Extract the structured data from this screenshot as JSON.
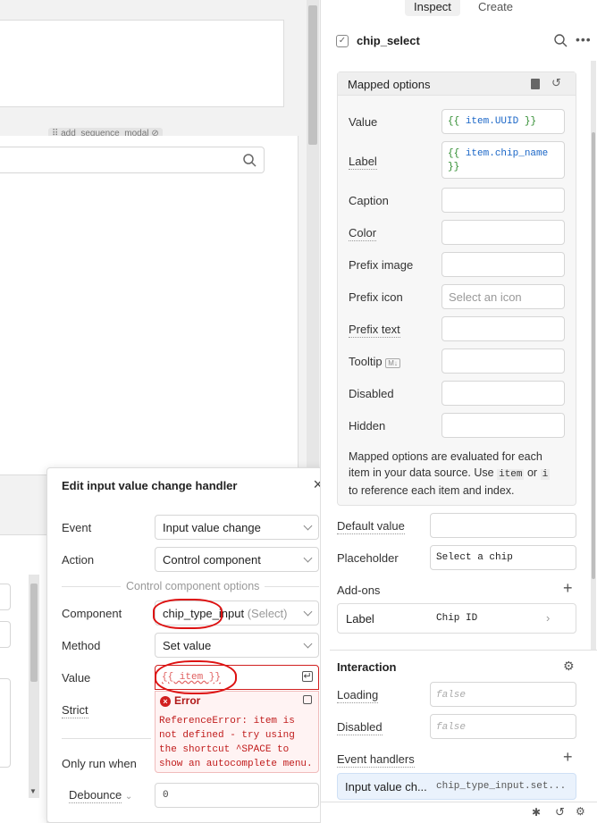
{
  "tabs": {
    "inspect": "Inspect",
    "create": "Create"
  },
  "component": {
    "name": "chip_select"
  },
  "mapped_options": {
    "title": "Mapped options",
    "value_label": "Value",
    "value": "{{ item.UUID }}",
    "label_label": "Label",
    "label_line1": "{{ item.chip_name",
    "label_line2": "}}",
    "caption_label": "Caption",
    "color_label": "Color",
    "prefix_image_label": "Prefix image",
    "prefix_icon_label": "Prefix icon",
    "prefix_icon_placeholder": "Select an icon",
    "prefix_text_label": "Prefix text",
    "tooltip_label": "Tooltip",
    "tooltip_badge": "M↓",
    "disabled_label": "Disabled",
    "hidden_label": "Hidden",
    "help_1": "Mapped options are evaluated for each",
    "help_2a": "item in your data source. Use",
    "help_code1": "item",
    "help_or": "or",
    "help_code2": "i",
    "help_3": "to reference each item and index."
  },
  "default_value_label": "Default value",
  "placeholder_label": "Placeholder",
  "placeholder_value": "Select a chip",
  "addons": {
    "title": "Add-ons",
    "label": "Label",
    "value": "Chip ID"
  },
  "interaction": {
    "title": "Interaction",
    "loading_label": "Loading",
    "loading_value": "false",
    "disabled_label": "Disabled",
    "disabled_value": "false",
    "event_handlers_label": "Event handlers",
    "handler_event": "Input value ch...",
    "handler_action": "chip_type_input.set..."
  },
  "canvas": {
    "modal_tag": "add_sequence_modal"
  },
  "modal": {
    "title": "Edit input value change handler",
    "event_label": "Event",
    "event_value": "Input value change",
    "action_label": "Action",
    "action_value": "Control component",
    "section": "Control component options",
    "component_label": "Component",
    "component_value": "chip_type_input",
    "component_type": "(Select)",
    "method_label": "Method",
    "method_value": "Set value",
    "value_label": "Value",
    "value_value": "{{ item }}",
    "strict_label": "Strict",
    "error_title": "Error",
    "error_line1": "ReferenceError: item is",
    "error_line2": "not defined - try using",
    "error_line3": "the shortcut ^SPACE to",
    "error_line4": "show an autocomplete menu.",
    "only_run_label": "Only run when",
    "debounce_label": "Debounce",
    "debounce_value": "0"
  },
  "colors": {
    "error": "#d11f1f",
    "accent_blue": "#1a66c7",
    "code_green": "#2b8a2b"
  }
}
